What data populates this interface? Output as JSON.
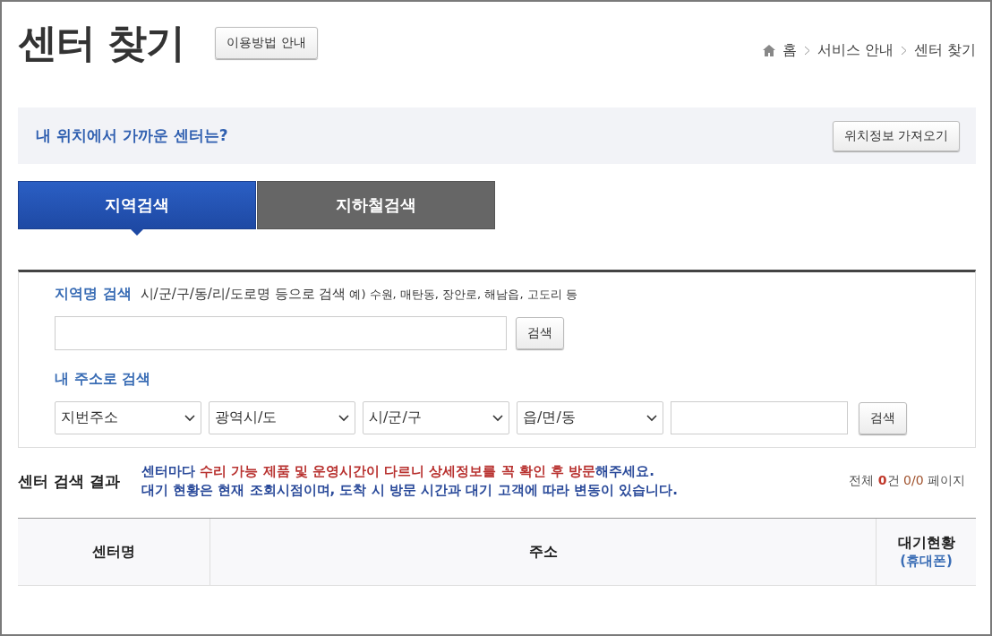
{
  "header": {
    "title": "센터 찾기",
    "guide_button": "이용방법 안내",
    "breadcrumb": [
      "홈",
      "서비스 안내",
      "센터 찾기"
    ]
  },
  "location_bar": {
    "prompt": "내 위치에서 가까운 센터는?",
    "button": "위치정보 가져오기"
  },
  "tabs": [
    {
      "label": "지역검색",
      "selected": true
    },
    {
      "label": "지하철검색",
      "selected": false
    }
  ],
  "region_search": {
    "label": "지역명 검색",
    "hint": "시/군/구/동/리/도로명 등으로 검색",
    "example": "예) 수원, 매탄동, 장안로, 해남읍, 고도리 등",
    "button": "검색"
  },
  "address_search": {
    "label": "내 주소로 검색",
    "selects": [
      "지번주소",
      "광역시/도",
      "시/군/구",
      "읍/면/동"
    ],
    "button": "검색"
  },
  "results": {
    "title": "센터 검색 결과",
    "notice_lines": [
      [
        {
          "text": "센터마다 ",
          "highlight": false
        },
        {
          "text": "수리 가능 제품 및 운영시간이 다르니 상세정보를 꼭 확인 후 방문",
          "highlight": true
        },
        {
          "text": "해주세요.",
          "highlight": false
        }
      ],
      [
        {
          "text": "대기 현황은 현재 조회시점이며, 도착 시 방문 시간과 대기 고객에 따라 변동이 있습니다.",
          "highlight": false
        }
      ]
    ],
    "count": [
      {
        "text": "전체 ",
        "kind": "plain"
      },
      {
        "text": "0",
        "kind": "strong"
      },
      {
        "text": "건 ",
        "kind": "plain"
      },
      {
        "text": "0/0",
        "kind": "soft"
      },
      {
        "text": " 페이지",
        "kind": "plain"
      }
    ],
    "columns": [
      {
        "label": "센터명"
      },
      {
        "label": "주소"
      },
      {
        "label": "대기현황",
        "sub": "(휴대폰)"
      }
    ]
  }
}
